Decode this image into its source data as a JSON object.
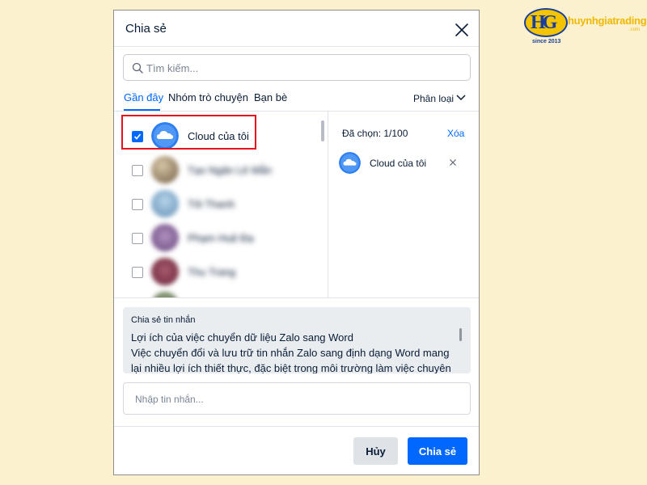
{
  "brand": {
    "logo_text": "huynhgiatrading",
    "logo_domain": ".com",
    "since": "since 2013"
  },
  "dialog": {
    "title": "Chia sẻ",
    "search_placeholder": "Tìm kiếm...",
    "tabs": [
      {
        "label": "Gần đây",
        "active": true
      },
      {
        "label": "Nhóm trò chuyện",
        "active": false
      },
      {
        "label": "Bạn bè",
        "active": false
      }
    ],
    "filter_label": "Phân loại",
    "contacts": [
      {
        "name": "Cloud của tôi",
        "checked": true,
        "avatar": "cloud",
        "blurred": false
      },
      {
        "name": "Tạo Ngân Lê Mẫn",
        "checked": false,
        "avatar": "photo",
        "blurred": true
      },
      {
        "name": "Tôi Thanh",
        "checked": false,
        "avatar": "photo",
        "blurred": true
      },
      {
        "name": "Phạm Huệ Đạ",
        "checked": false,
        "avatar": "photo",
        "blurred": true
      },
      {
        "name": "Thu Trang",
        "checked": false,
        "avatar": "photo",
        "blurred": true
      }
    ],
    "selected_panel": {
      "count_label": "Đã chọn: 1/100",
      "clear_label": "Xóa",
      "items": [
        {
          "name": "Cloud của tôi",
          "avatar": "cloud"
        }
      ]
    },
    "share_message": {
      "label": "Chia sẻ tin nhắn",
      "lines": [
        "Lợi ích của việc chuyển dữ liệu Zalo sang Word",
        "Việc chuyển đổi và lưu trữ tin nhắn Zalo sang định dạng Word mang",
        "lại nhiều lợi ích thiết thực, đặc biệt trong môi trường làm việc chuyên"
      ]
    },
    "message_input_placeholder": "Nhập tin nhắn...",
    "buttons": {
      "cancel": "Hủy",
      "share": "Chia sẻ"
    }
  },
  "colors": {
    "accent": "#0068ff",
    "highlight_box": "#e5101c",
    "page_background": "#fbf1cf",
    "cancel_button": "#dfe2e7",
    "message_box": "#eaedf0"
  }
}
